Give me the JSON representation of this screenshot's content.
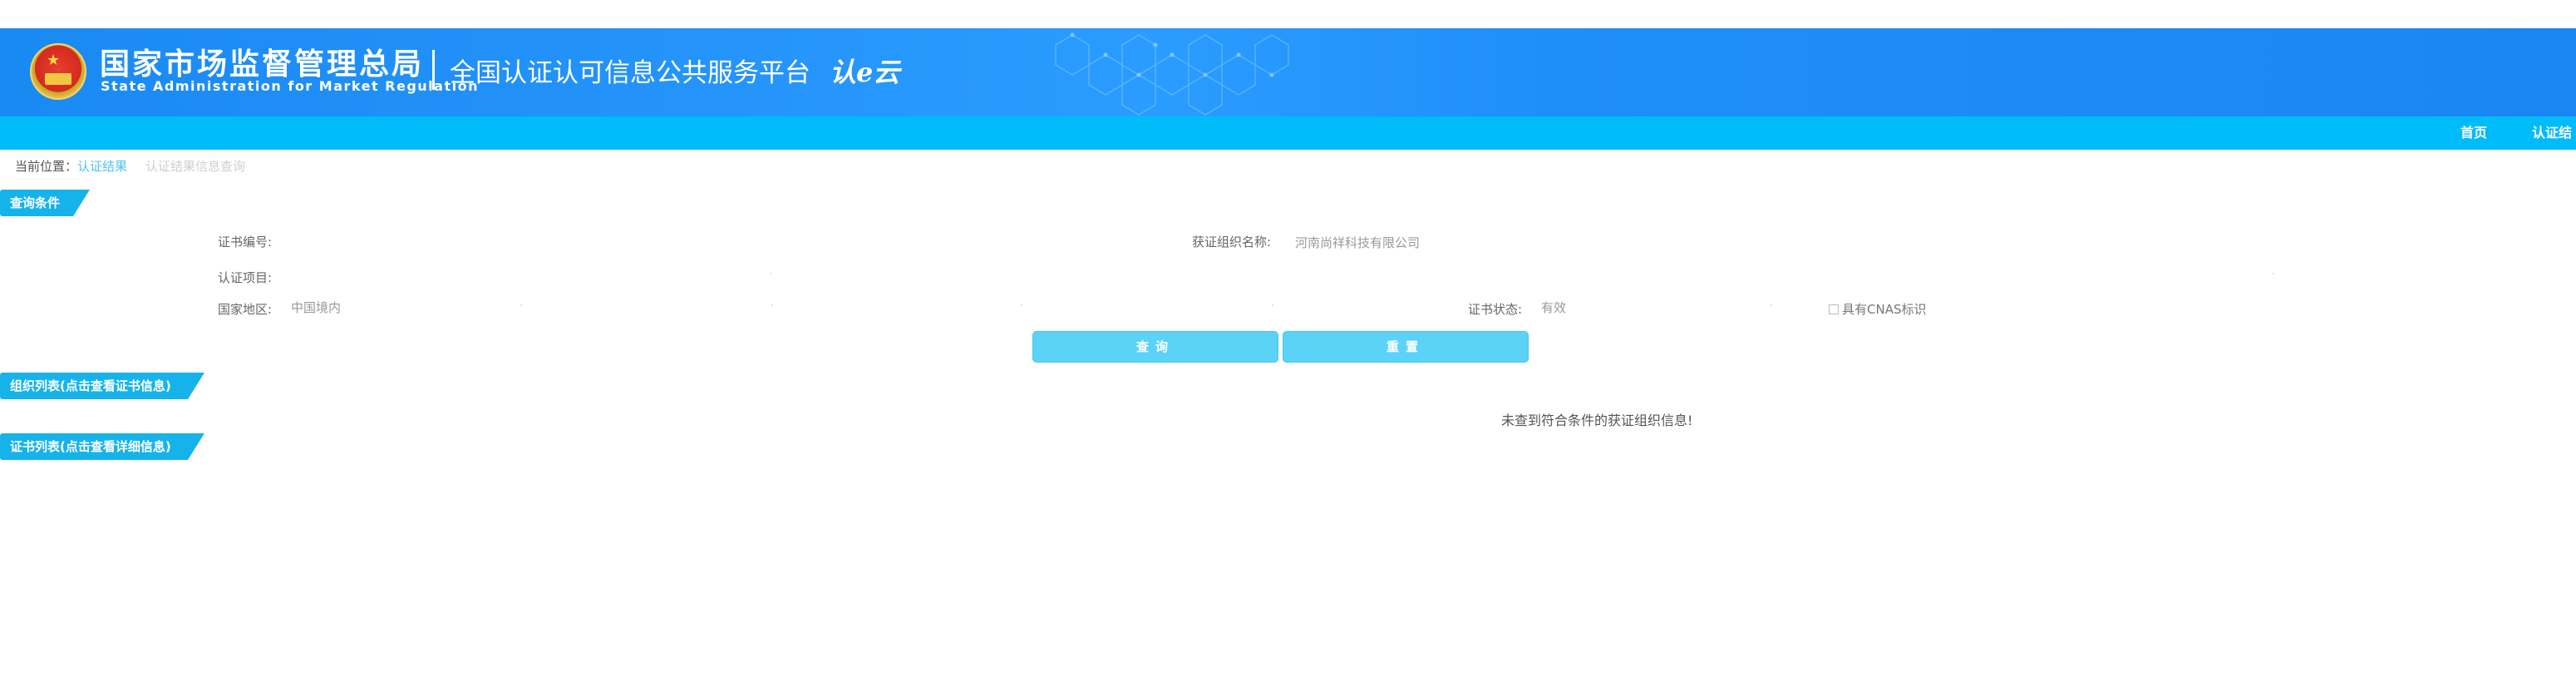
{
  "header": {
    "org_name_cn": "国家市场监督管理总局",
    "org_name_en": "State Administration  for  Market Regulation",
    "platform_name": "全国认证认可信息公共服务平台",
    "logo_text": "认e云"
  },
  "nav": {
    "items": [
      {
        "label": "首页"
      },
      {
        "label": "认证结"
      }
    ]
  },
  "breadcrumb": {
    "prefix": "当前位置：",
    "link": "认证结果",
    "current": "认证结果信息查询"
  },
  "query_section": {
    "title": "查询条件",
    "cert_no_label": "证书编号:",
    "cert_no_value": "",
    "org_name_label": "获证组织名称:",
    "org_name_value": "河南尚祥科技有限公司",
    "project_label": "认证项目:",
    "country_label": "国家地区:",
    "country_value": "中国境内",
    "status_label": "证书状态:",
    "status_value": "有效",
    "cnas_label": "具有CNAS标识",
    "search_button": "查询",
    "reset_button": "重置"
  },
  "org_list_section": {
    "title": "组织列表(点击查看证书信息)",
    "empty_message": "未查到符合条件的获证组织信息!"
  },
  "cert_list_section": {
    "title": "证书列表(点击查看详细信息)"
  },
  "colors": {
    "banner_blue": "#1a8af3",
    "nav_cyan": "#00bbf9",
    "section_head": "#16b3ea",
    "button": "#5bd3f7"
  }
}
